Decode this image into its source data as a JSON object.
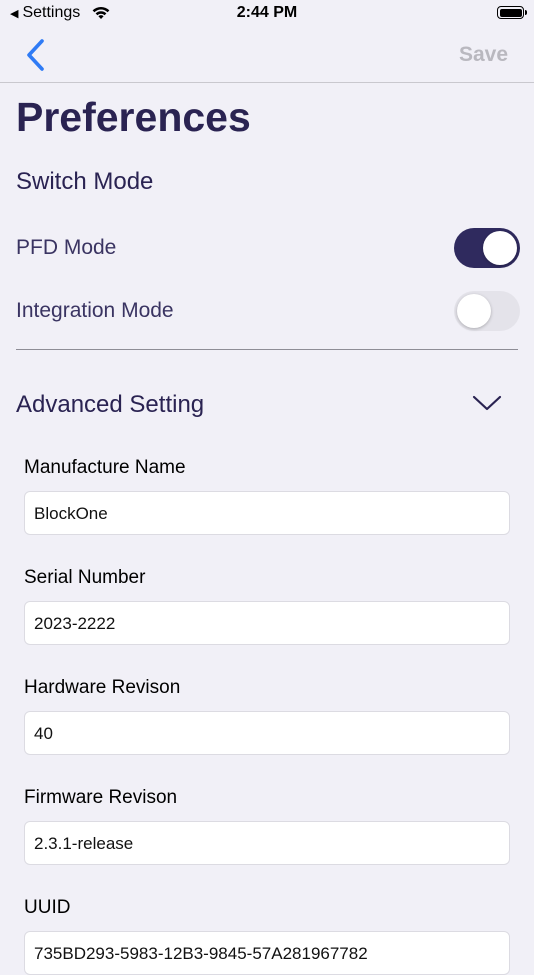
{
  "status_bar": {
    "back_label": "Settings",
    "time": "2:44 PM"
  },
  "nav": {
    "save_label": "Save",
    "accent_color": "#2f7bf5",
    "save_color_disabled": "#b9b8bf"
  },
  "page": {
    "title": "Preferences"
  },
  "switch_mode": {
    "title": "Switch Mode",
    "items": [
      {
        "label": "PFD Mode",
        "on": true
      },
      {
        "label": "Integration Mode",
        "on": false
      }
    ],
    "toggle_on_color": "#2f2a5e"
  },
  "advanced": {
    "title": "Advanced Setting",
    "expanded": true,
    "fields": [
      {
        "label": "Manufacture Name",
        "value": "BlockOne"
      },
      {
        "label": "Serial Number",
        "value": "2023-2222"
      },
      {
        "label": "Hardware Revison",
        "value": "40"
      },
      {
        "label": "Firmware Revison",
        "value": "2.3.1-release"
      },
      {
        "label": "UUID",
        "value": "735BD293-5983-12B3-9845-57A281967782"
      }
    ]
  }
}
